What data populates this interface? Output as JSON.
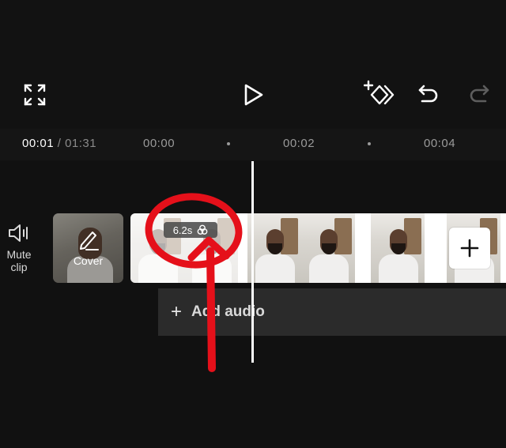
{
  "toolbar": {
    "fullscreen_icon": "expand-icon",
    "play_icon": "play-icon",
    "keyframe_icon": "add-keyframe-icon",
    "undo_icon": "undo-icon",
    "redo_icon": "redo-icon"
  },
  "ruler": {
    "current_time": "00:01",
    "separator": " / ",
    "total_time": "01:31",
    "ticks": [
      "00:00",
      "00:02",
      "00:04"
    ]
  },
  "track": {
    "mute_label_line1": "Mute",
    "mute_label_line2": "clip",
    "cover_label": "Cover",
    "clip_duration": "6.2s",
    "add_audio_label": "Add audio"
  },
  "colors": {
    "background": "#111111",
    "annotation": "#e5101a",
    "audio_track": "#2b2b2b"
  }
}
